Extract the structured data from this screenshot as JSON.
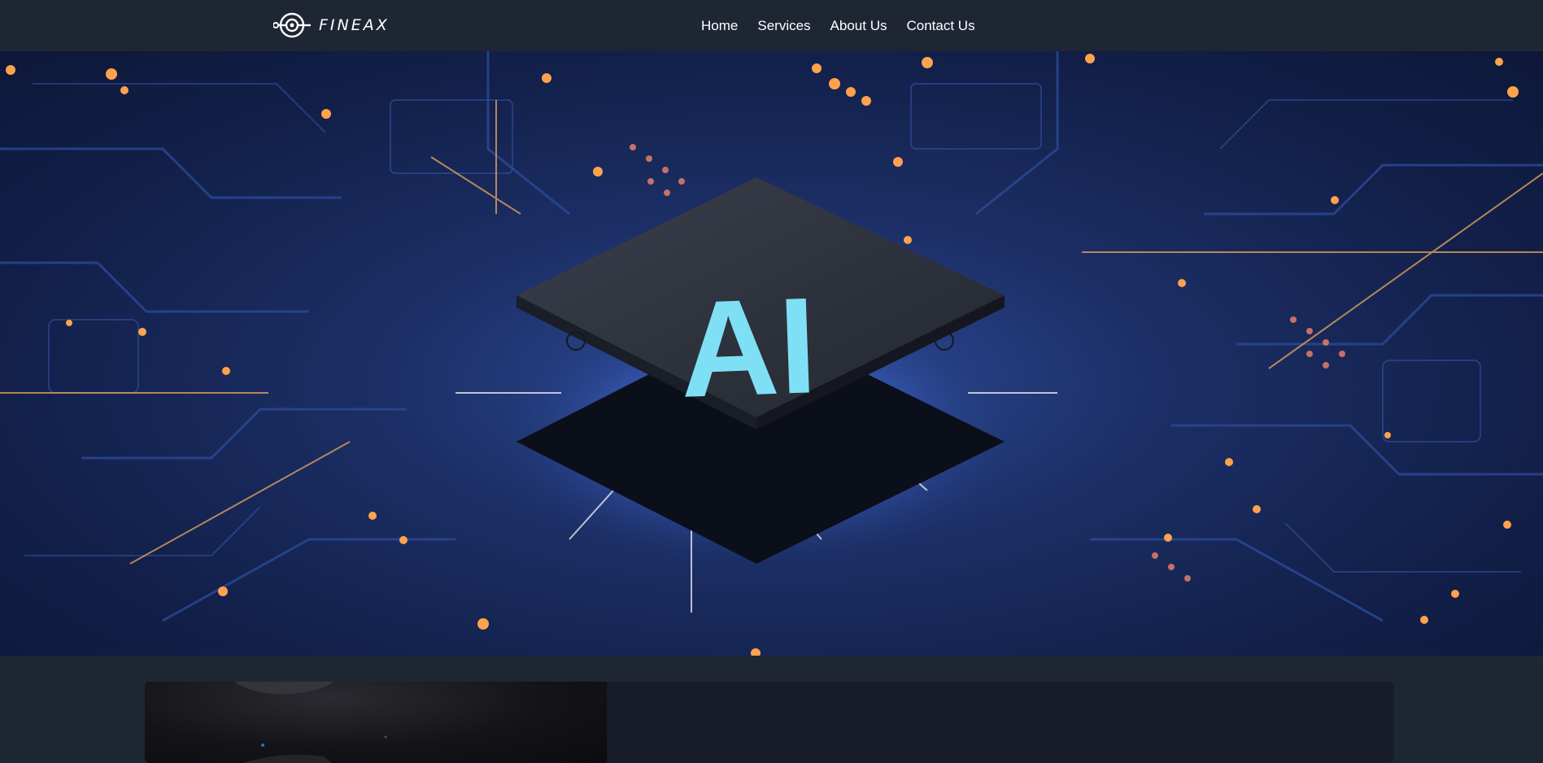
{
  "brand": {
    "name": "FINEAX",
    "logo_icon": "fineax-logo-icon"
  },
  "nav": {
    "items": [
      {
        "label": "Home"
      },
      {
        "label": "Services"
      },
      {
        "label": "About Us"
      },
      {
        "label": "Contact Us"
      }
    ]
  },
  "hero": {
    "chip_text": "AI",
    "colors": {
      "chip_text": "#7fe0f5",
      "glow": "#4f7dff",
      "lights": "#ff9a4a"
    }
  },
  "colors": {
    "page_bg": "#1f2633",
    "card_bg": "#161c28"
  }
}
